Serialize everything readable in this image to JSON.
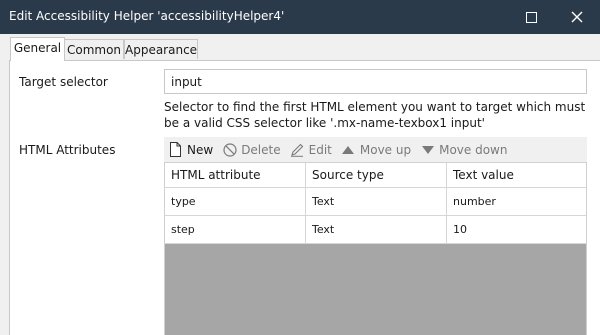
{
  "window": {
    "title": "Edit Accessibility Helper 'accessibilityHelper4'"
  },
  "tabs": [
    {
      "label": "General",
      "active": true
    },
    {
      "label": "Common",
      "active": false
    },
    {
      "label": "Appearance",
      "active": false
    }
  ],
  "general": {
    "target_selector_label": "Target selector",
    "target_selector_value": "input",
    "target_selector_help": "Selector to find the first HTML element you want to target which must be a valid CSS selector like '.mx-name-texbox1 input'",
    "html_attributes_label": "HTML Attributes"
  },
  "toolbar": {
    "new_label": "New",
    "delete_label": "Delete",
    "edit_label": "Edit",
    "move_up_label": "Move up",
    "move_down_label": "Move down"
  },
  "table": {
    "headers": [
      "HTML attribute",
      "Source type",
      "Text value"
    ],
    "rows": [
      [
        "type",
        "Text",
        "number"
      ],
      [
        "step",
        "Text",
        "10"
      ]
    ]
  },
  "colors": {
    "titlebar": "#2b3a4a",
    "dialog_bg": "#f0f0f0",
    "grid_empty": "#a6a6a6"
  }
}
